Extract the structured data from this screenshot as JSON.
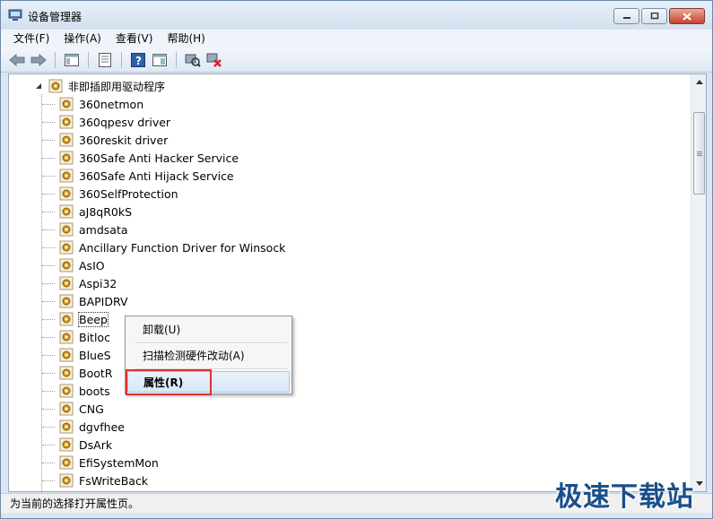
{
  "window": {
    "title": "设备管理器"
  },
  "menu": [
    "文件(F)",
    "操作(A)",
    "查看(V)",
    "帮助(H)"
  ],
  "tree": {
    "root": "非即插即用驱动程序",
    "items": [
      "360netmon",
      "360qpesv driver",
      "360reskit driver",
      "360Safe Anti Hacker Service",
      "360Safe Anti Hijack Service",
      "360SelfProtection",
      "aJ8qR0kS",
      "amdsata",
      "Ancillary Function Driver for Winsock",
      "AsIO",
      "Aspi32",
      "BAPIDRV",
      "Beep",
      "Bitloc",
      "BlueS",
      "BootR",
      "boots",
      "CNG",
      "dgvfhee",
      "DsArk",
      "EfiSystemMon",
      "FsWriteBack"
    ],
    "selected_index": 12
  },
  "context_menu": {
    "uninstall": "卸载(U)",
    "scan": "扫描检测硬件改动(A)",
    "properties": "属性(R)"
  },
  "status": "为当前的选择打开属性页。",
  "watermark": "极速下载站",
  "colors": {
    "highlight_border": "#e0322b",
    "title_bg": "#dbe6f3",
    "accent": "#1a4f8a"
  }
}
